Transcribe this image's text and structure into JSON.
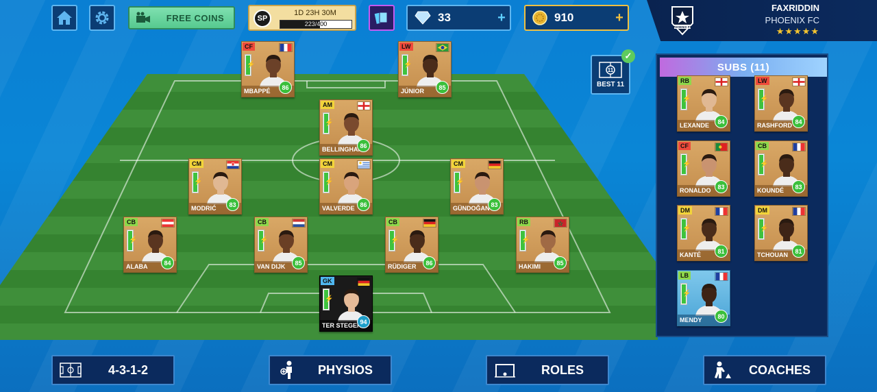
{
  "topbar": {
    "free_coins_label": "FREE COINS",
    "sp": {
      "badge": "SP",
      "timer": "1D 23H 30M",
      "progress_text": "223/400",
      "progress": 0.5575
    },
    "gems": "33",
    "coins": "910",
    "plus": "+"
  },
  "club": {
    "manager": "FAXRIDDIN",
    "team": "PHOENIX FC",
    "stars": "★★★★★",
    "logo_text": "PHOENIX FC"
  },
  "best11": {
    "label": "BEST 11",
    "badge": "11",
    "check": "✓"
  },
  "lineup": [
    {
      "pos": "CF",
      "role": "fw",
      "name": "MBAPPÉ",
      "rating": "86",
      "flag": "fr",
      "skin": "#6b4128"
    },
    {
      "pos": "LW",
      "role": "fw",
      "name": "JÚNIOR",
      "rating": "85",
      "flag": "br",
      "skin": "#4a2c1a"
    },
    {
      "pos": "AM",
      "role": "mf",
      "name": "BELLINGHAM",
      "rating": "86",
      "flag": "en",
      "skin": "#7a4a2e"
    },
    {
      "pos": "CM",
      "role": "mf",
      "name": "MODRIĆ",
      "rating": "83",
      "flag": "hr",
      "skin": "#e0b893"
    },
    {
      "pos": "CM",
      "role": "mf",
      "name": "VALVERDE",
      "rating": "86",
      "flag": "uy",
      "skin": "#d9a47c"
    },
    {
      "pos": "CM",
      "role": "mf",
      "name": "GÜNDOĞAN",
      "rating": "83",
      "flag": "de",
      "skin": "#c99370"
    },
    {
      "pos": "CB",
      "role": "df",
      "name": "ALABA",
      "rating": "84",
      "flag": "at",
      "skin": "#5a3520"
    },
    {
      "pos": "CB",
      "role": "df",
      "name": "VAN DIJK",
      "rating": "85",
      "flag": "nl",
      "skin": "#6a3f25"
    },
    {
      "pos": "CB",
      "role": "df",
      "name": "RÜDIGER",
      "rating": "86",
      "flag": "de",
      "skin": "#4a2c1a"
    },
    {
      "pos": "RB",
      "role": "df",
      "name": "HAKIMI",
      "rating": "85",
      "flag": "ma",
      "skin": "#a06a45"
    },
    {
      "pos": "GK",
      "role": "gkc",
      "name": "TER STEGEN",
      "rating": "94",
      "flag": "de",
      "skin": "#e6bb98"
    }
  ],
  "subs": {
    "title": "SUBS (11)",
    "players": [
      {
        "pos": "RB",
        "role": "df",
        "name": "LEXANDE",
        "rating": "84",
        "flag": "en",
        "skin": "#e0b893"
      },
      {
        "pos": "LW",
        "role": "fw",
        "name": "RASHFORD",
        "rating": "84",
        "flag": "en",
        "skin": "#5a3520"
      },
      {
        "pos": "CF",
        "role": "fw",
        "name": "RONALDO",
        "rating": "83",
        "flag": "pt",
        "skin": "#c99370"
      },
      {
        "pos": "CB",
        "role": "df",
        "name": "KOUNDÉ",
        "rating": "83",
        "flag": "fr",
        "skin": "#4a2c1a"
      },
      {
        "pos": "DM",
        "role": "mf",
        "name": "KANTÉ",
        "rating": "81",
        "flag": "fr",
        "skin": "#4a2c1a"
      },
      {
        "pos": "DM",
        "role": "mf",
        "name": "TCHOUAN",
        "rating": "81",
        "flag": "fr",
        "skin": "#3e2416"
      },
      {
        "pos": "LB",
        "role": "df",
        "name": "MENDY",
        "rating": "80",
        "flag": "fr",
        "skin": "#3e2416",
        "rare": true
      }
    ]
  },
  "bottom": {
    "formation": "4-3-1-2",
    "physios": "PHYSIOS",
    "roles": "ROLES",
    "coaches": "COACHES"
  },
  "colors": {
    "pitch_light": "#3f8f3a",
    "pitch_dark": "#2f7a2c",
    "accent": "#3d87cf",
    "gold": "#f0c040"
  }
}
